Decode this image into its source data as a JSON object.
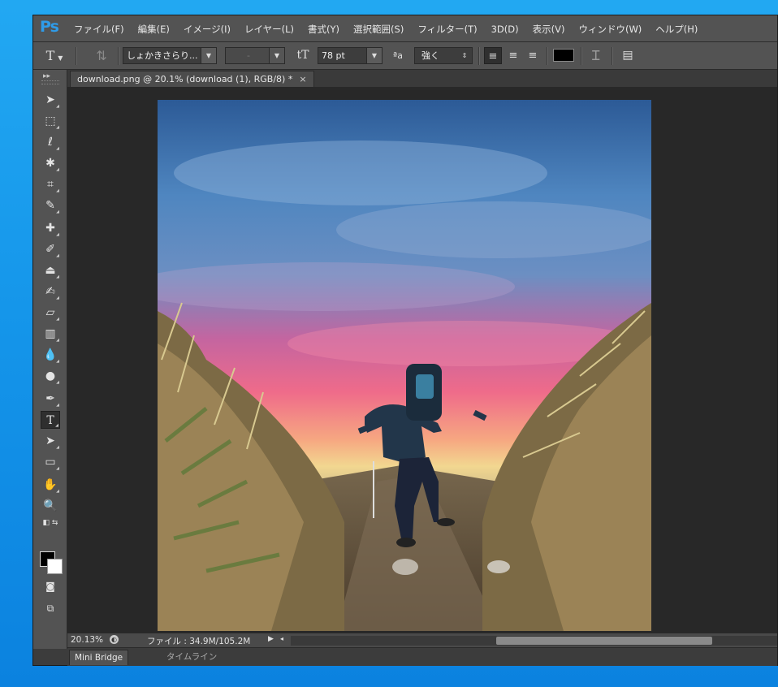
{
  "app": {
    "logo": "Ps"
  },
  "menu": [
    "ファイル(F)",
    "編集(E)",
    "イメージ(I)",
    "レイヤー(L)",
    "書式(Y)",
    "選択範囲(S)",
    "フィルター(T)",
    "3D(D)",
    "表示(V)",
    "ウィンドウ(W)",
    "ヘルプ(H)"
  ],
  "options": {
    "font_family": "しょかきさらり...",
    "font_style": "-",
    "font_size": "78 pt",
    "antialias_icon": "ªa",
    "antialias": "強く",
    "text_color": "#000000"
  },
  "document": {
    "tab_title": "download.png @ 20.1% (download (1), RGB/8) *",
    "close": "×"
  },
  "toolbar": {
    "collapse": "▸▸"
  },
  "status": {
    "zoom": "20.13%",
    "file_info": "ファイル : 34.9M/105.2M",
    "play": "▶",
    "scroll_left": "◂"
  },
  "panels": [
    "Mini Bridge",
    "タイムライン"
  ],
  "colors": {
    "foreground": "#000000",
    "background": "#ffffff",
    "accent": "#2f9be8"
  }
}
